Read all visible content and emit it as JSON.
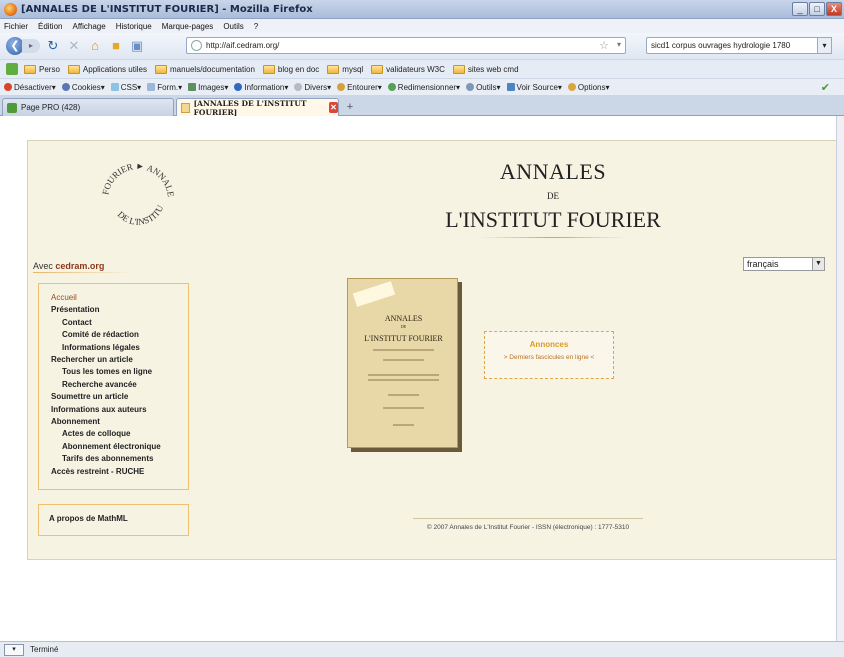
{
  "window": {
    "title": "[ANNALES DE L'INSTITUT FOURIER] - Mozilla Firefox",
    "buttons": [
      "_",
      "□",
      "X"
    ]
  },
  "menubar": [
    "Fichier",
    "Édition",
    "Affichage",
    "Historique",
    "Marque-pages",
    "Outils",
    "?"
  ],
  "nav": {
    "url": "http://aif.cedram.org/",
    "search": "sicd1 corpus ouvrages hydrologie 1780"
  },
  "bookmarks": [
    "Perso",
    "Applications utiles",
    "manuels/documentation",
    "blog en doc",
    "mysql",
    "validateurs W3C",
    "sites web cmd"
  ],
  "devtoolbar": [
    "Désactiver▾",
    "Cookies▾",
    "CSS▾",
    "Form.▾",
    "Images▾",
    "Information▾",
    "Divers▾",
    "Entourer▾",
    "Redimensionner▾",
    "Outils▾",
    "Voir Source▾",
    "Options▾"
  ],
  "tabs": [
    {
      "label": "Page PRO (428)",
      "active": false
    },
    {
      "label": "[ANNALES DE L'INSTITUT FOURIER]",
      "active": true
    }
  ],
  "page": {
    "seal_text_top": "FOURIER ► ANNALES",
    "seal_text_bottom": "DE L'INSTITUT",
    "title_line1": "ANNALES",
    "title_line2": "DE",
    "title_line3": "L'INSTITUT FOURIER",
    "avec_prefix": "Avec ",
    "avec_link": "cedram.org",
    "language": "français",
    "menu": [
      {
        "label": "Accueil",
        "level": 1
      },
      {
        "label": "Présentation",
        "level": 1
      },
      {
        "label": "Contact",
        "level": 2
      },
      {
        "label": "Comité de rédaction",
        "level": 2
      },
      {
        "label": "Informations légales",
        "level": 2
      },
      {
        "label": "Rechercher un article",
        "level": 1
      },
      {
        "label": "Tous les tomes en ligne",
        "level": 2
      },
      {
        "label": "Recherche avancée",
        "level": 2
      },
      {
        "label": "Soumettre un article",
        "level": 1
      },
      {
        "label": "Informations aux auteurs",
        "level": 1
      },
      {
        "label": "Abonnement",
        "level": 1
      },
      {
        "label": "Actes de colloque",
        "level": 2
      },
      {
        "label": "Abonnement électronique",
        "level": 2
      },
      {
        "label": "Tarifs des abonnements",
        "level": 2
      },
      {
        "label": "Accès restreint - RUCHE",
        "level": 1
      }
    ],
    "apropos": "A propos de MathML",
    "cover": {
      "line1": "ANNALES",
      "line2": "DE",
      "line3": "L'INSTITUT FOURIER"
    },
    "annonces": {
      "title": "Annonces",
      "link": "> Derniers fascicules en ligne <"
    },
    "footer": "© 2007 Annales de L'Institut Fourier - ISSN (électronique) : 1777-5310"
  },
  "status": "Terminé"
}
